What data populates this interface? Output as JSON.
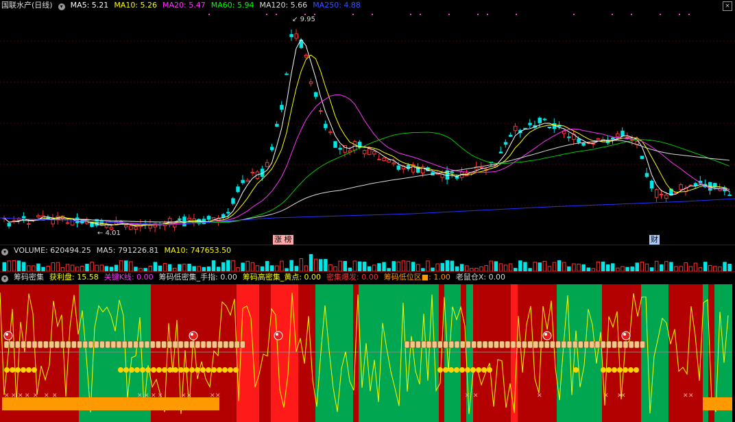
{
  "main": {
    "stock_name": "国联水产(日线)",
    "ma_labels": [
      {
        "text": "MA5: 5.21",
        "color": "#ffffff"
      },
      {
        "text": "MA10: 5.26",
        "color": "#ffff00"
      },
      {
        "text": "MA20: 5.47",
        "color": "#ff33ff"
      },
      {
        "text": "MA60: 5.94",
        "color": "#00ff00"
      },
      {
        "text": "MA120: 5.66",
        "color": "#dddddd"
      },
      {
        "text": "MA250: 4.88",
        "color": "#3355ff"
      }
    ],
    "high_label": "9.95",
    "low_label": "4.01",
    "event_tag_1": "涨 榜",
    "event_tag_2": "财"
  },
  "volume": {
    "label": "VOLUME: 620494.25",
    "ma5": "MA5: 791226.81",
    "ma10": "MA10: 747653.50"
  },
  "chip": {
    "title": "筹码密集",
    "items": [
      {
        "text": "获利盘: 15.58",
        "color": "#ffff00"
      },
      {
        "text": "关键K线: 0.00",
        "color": "#ff33ff"
      },
      {
        "text": "筹码低密集_手指: 0.00",
        "color": "#dddddd"
      },
      {
        "text": "筹码高密集_黄点: 0.00",
        "color": "#ffff00"
      },
      {
        "text": "密集爆发: 0.00",
        "color": "#ff3333"
      },
      {
        "text": "筹码低位区■: 1.00",
        "color": "#ff9900"
      },
      {
        "text": "老鼠仓X: 0.00",
        "color": "#dddddd"
      }
    ]
  },
  "colors": {
    "up": "#ff3333",
    "down": "#00e5e5",
    "bg": "#000000",
    "grid": "#8a0000"
  }
}
